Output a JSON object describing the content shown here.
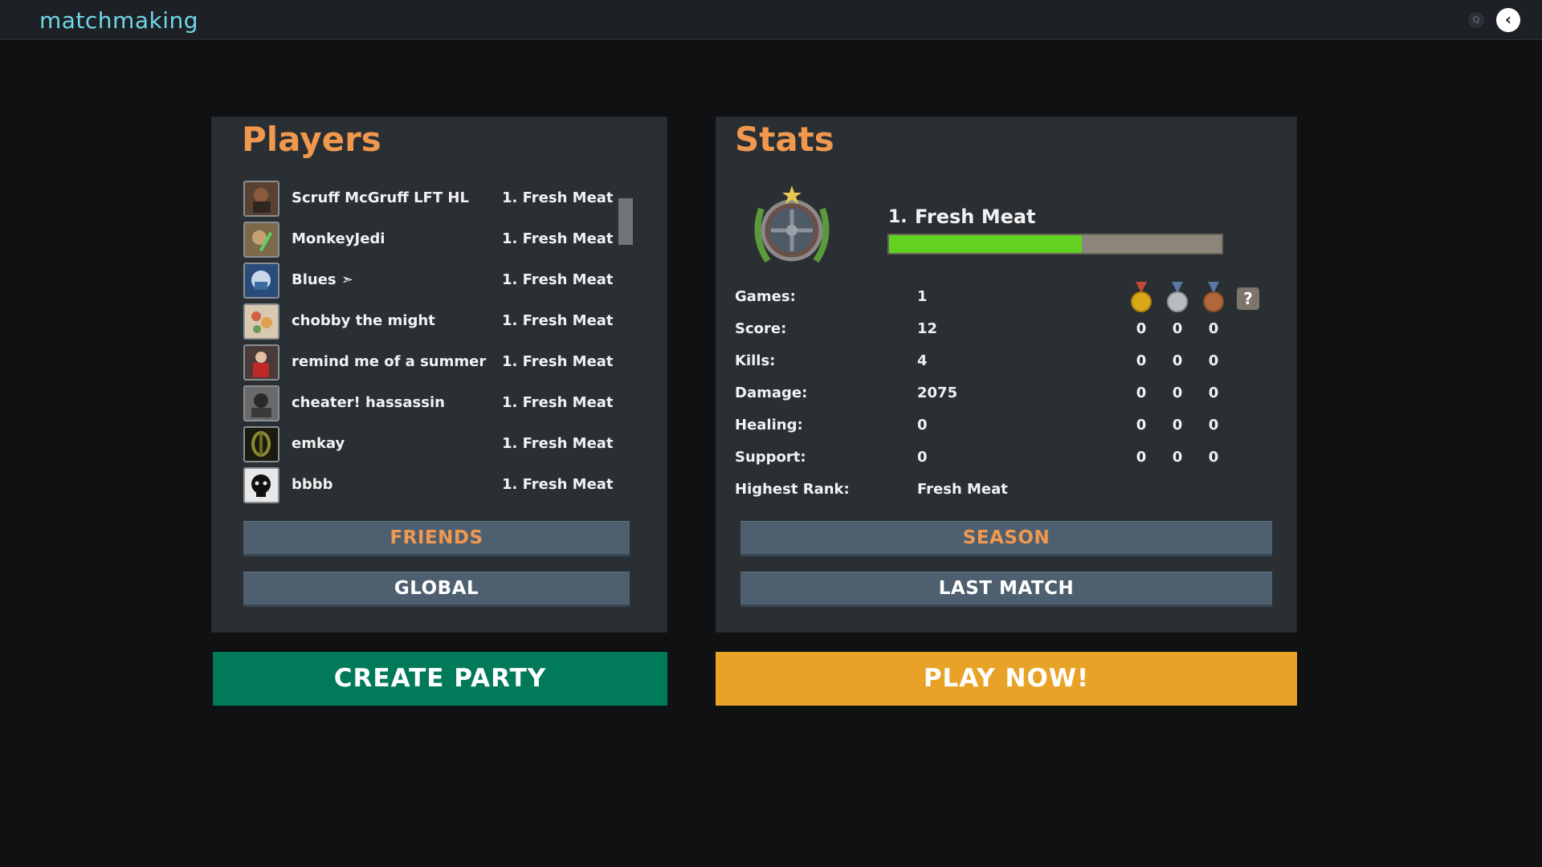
{
  "app": {
    "title": "matchmaking"
  },
  "topbar": {
    "search_icon": "search-icon",
    "back_icon": "chevron-left-icon",
    "search_glyph": "Q",
    "back_glyph": "‹"
  },
  "players": {
    "title": "Players",
    "list": [
      {
        "name": "Scruff McGruff LFT HL",
        "rank": "1. Fresh Meat"
      },
      {
        "name": "MonkeyJedi",
        "rank": "1. Fresh Meat"
      },
      {
        "name": "Blues ➣",
        "rank": "1. Fresh Meat"
      },
      {
        "name": "chobby the might",
        "rank": "1. Fresh Meat"
      },
      {
        "name": "remind me of a summer",
        "rank": "1. Fresh Meat"
      },
      {
        "name": "cheater! hassassin",
        "rank": "1. Fresh Meat"
      },
      {
        "name": "emkay",
        "rank": "1. Fresh Meat"
      },
      {
        "name": "bbbb",
        "rank": "1. Fresh Meat"
      }
    ],
    "friends_label": "FRIENDS",
    "global_label": "GLOBAL"
  },
  "stats": {
    "title": "Stats",
    "rank_number": "1.",
    "rank_name": "Fresh Meat",
    "rank_progress": 0.58,
    "rows": [
      {
        "label": "Games:",
        "value": "1"
      },
      {
        "label": "Score:",
        "value": "12",
        "gold": "0",
        "silver": "0",
        "bronze": "0"
      },
      {
        "label": "Kills:",
        "value": "4",
        "gold": "0",
        "silver": "0",
        "bronze": "0"
      },
      {
        "label": "Damage:",
        "value": "2075",
        "gold": "0",
        "silver": "0",
        "bronze": "0"
      },
      {
        "label": "Healing:",
        "value": "0",
        "gold": "0",
        "silver": "0",
        "bronze": "0"
      },
      {
        "label": "Support:",
        "value": "0",
        "gold": "0",
        "silver": "0",
        "bronze": "0"
      },
      {
        "label": "Highest Rank:",
        "value": "Fresh Meat"
      }
    ],
    "medal_icons": [
      "gold-medal-icon",
      "silver-medal-icon",
      "bronze-medal-icon"
    ],
    "help_glyph": "?",
    "season_label": "SEASON",
    "last_match_label": "LAST MATCH"
  },
  "actions": {
    "create_party_label": "CREATE PARTY",
    "play_now_label": "PLAY NOW!"
  },
  "colors": {
    "accent": "#f0984e",
    "create_party": "#007a58",
    "play_now": "#e8a227",
    "progress_fill": "#62d21e",
    "title_cyan": "#6fd6e8"
  }
}
